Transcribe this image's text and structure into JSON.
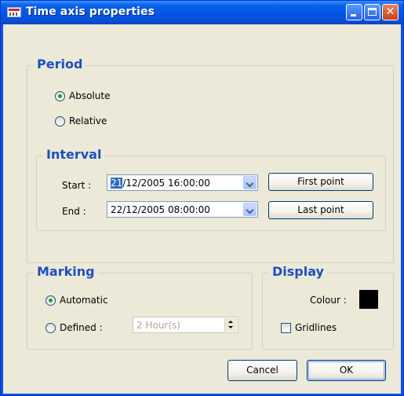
{
  "window": {
    "title": "Time axis properties"
  },
  "period": {
    "legend": "Period",
    "absolute_label": "Absolute",
    "relative_label": "Relative",
    "selected": "Absolute"
  },
  "interval": {
    "legend": "Interval",
    "start_label": "Start :",
    "start_value_highlight": "21",
    "start_value_rest": "/12/2005 16:00:00",
    "end_label": "End :",
    "end_value": "22/12/2005 08:00:00",
    "first_point_label": "First point",
    "last_point_label": "Last point"
  },
  "marking": {
    "legend": "Marking",
    "automatic_label": "Automatic",
    "defined_label": "Defined :",
    "defined_value": "2 Hour(s)",
    "selected": "Automatic"
  },
  "display": {
    "legend": "Display",
    "colour_label": "Colour :",
    "colour_value": "#000000",
    "gridlines_label": "Gridlines",
    "gridlines_checked": false
  },
  "footer": {
    "cancel_label": "Cancel",
    "ok_label": "OK"
  },
  "icons": {
    "window_icon": "calendar-icon",
    "minimize": "minimize-icon",
    "maximize": "maximize-icon",
    "close": "close-icon"
  }
}
